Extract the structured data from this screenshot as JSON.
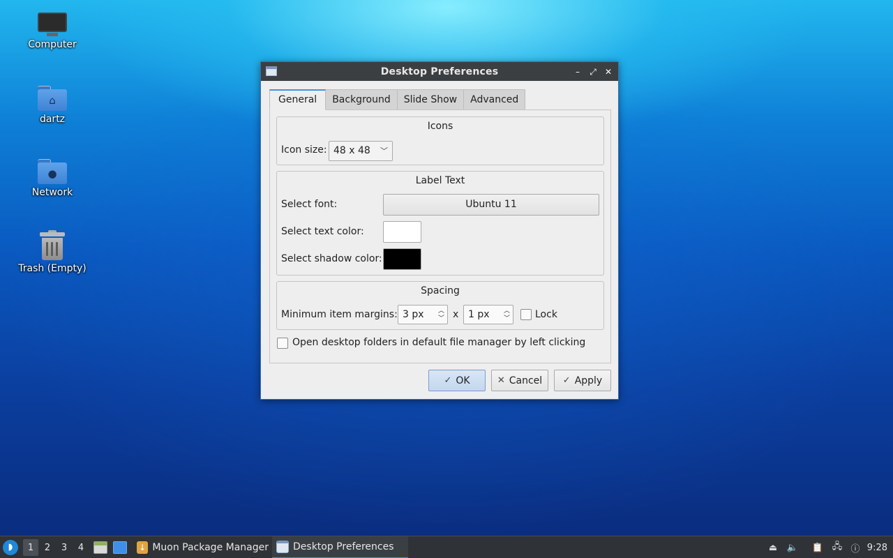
{
  "desktop": {
    "icons": [
      {
        "label": "Computer"
      },
      {
        "label": "dartz"
      },
      {
        "label": "Network"
      },
      {
        "label": "Trash (Empty)"
      }
    ]
  },
  "dialog": {
    "title": "Desktop Preferences",
    "tabs": [
      "General",
      "Background",
      "Slide Show",
      "Advanced"
    ],
    "icons_group": {
      "title": "Icons",
      "icon_size_label": "Icon size:",
      "icon_size_value": "48 x 48"
    },
    "label_text_group": {
      "title": "Label Text",
      "font_label": "Select font:",
      "font_value": "Ubuntu 11",
      "text_color_label": "Select text color:",
      "text_color": "#ffffff",
      "shadow_color_label": "Select shadow color:",
      "shadow_color": "#000000"
    },
    "spacing_group": {
      "title": "Spacing",
      "margins_label": "Minimum item margins:",
      "margin_x": "3 px",
      "separator": "x",
      "margin_y": "1 px",
      "lock_label": "Lock",
      "lock_checked": false
    },
    "open_folders_label": "Open desktop folders in default file manager by left clicking",
    "open_folders_checked": false,
    "buttons": {
      "ok": "OK",
      "cancel": "Cancel",
      "apply": "Apply"
    }
  },
  "taskbar": {
    "workspaces": [
      "1",
      "2",
      "3",
      "4"
    ],
    "active_workspace": "1",
    "tasks": [
      {
        "label": "Muon Package Manager",
        "active": false
      },
      {
        "label": "Desktop Preferences",
        "active": true
      }
    ],
    "clock": "9:28"
  },
  "colors": {
    "accent": "#4a90d9",
    "titlebar": "#3c3f42",
    "taskbar": "#2f3337"
  }
}
